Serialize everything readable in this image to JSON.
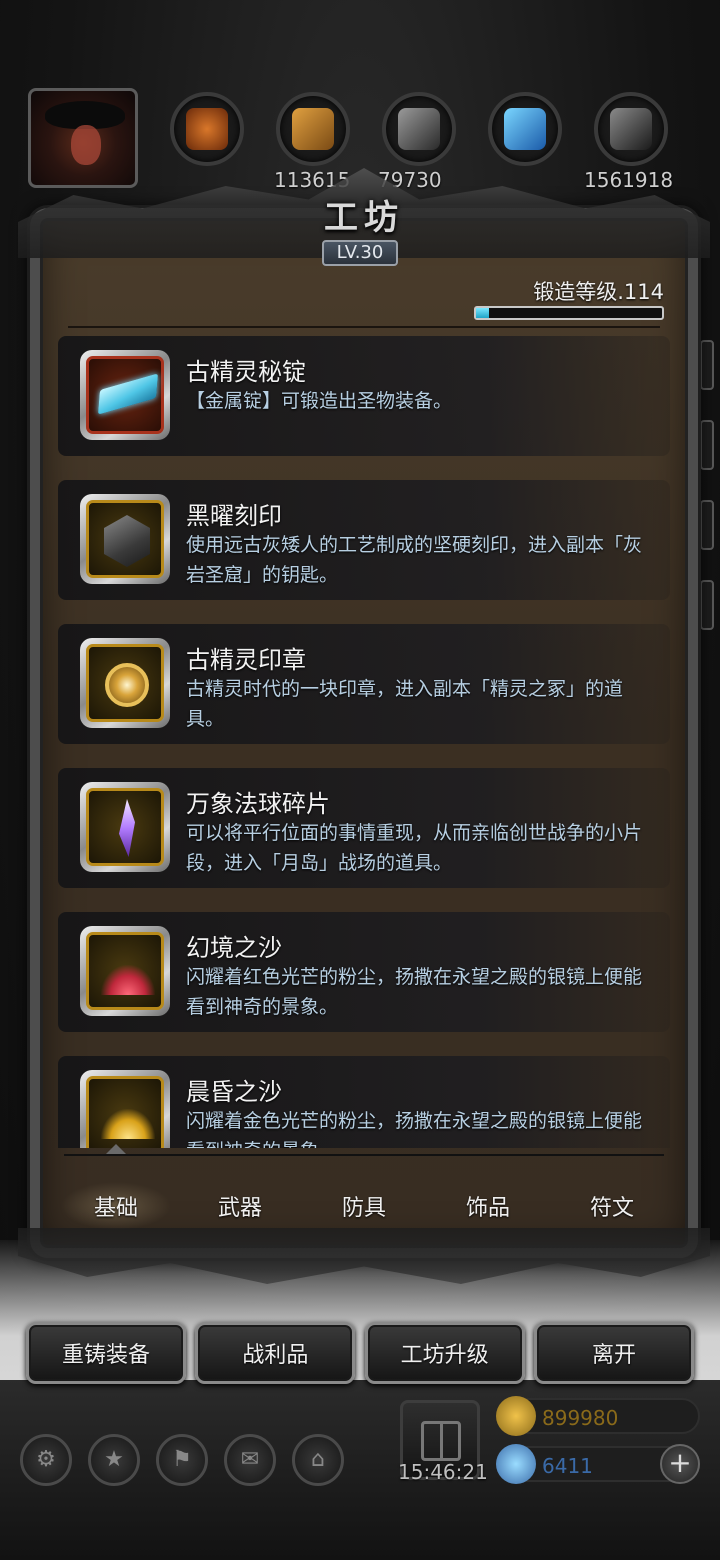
{
  "top_bar": {
    "resources": [
      {
        "icon": "ore-icon",
        "value": ""
      },
      {
        "icon": "wood-icon",
        "value": "113615"
      },
      {
        "icon": "stone-icon",
        "value": "79730"
      },
      {
        "icon": "crystal-icon",
        "value": ""
      },
      {
        "icon": "iron-icon",
        "value": "1561918"
      }
    ]
  },
  "panel": {
    "title": "工坊",
    "level": "LV.30",
    "forge_level_label": "锻造等级.114",
    "forge_progress": 0.07
  },
  "items": [
    {
      "title": "古精灵秘锭",
      "desc": "【金属锭】可锻造出圣物装备。",
      "icon": "ingot-icon",
      "frame": "red"
    },
    {
      "title": "黑曜刻印",
      "desc": "使用远古灰矮人的工艺制成的坚硬刻印，进入副本「灰岩圣窟」的钥匙。",
      "icon": "obsidian-seal-icon",
      "frame": "gold"
    },
    {
      "title": "古精灵印章",
      "desc": "古精灵时代的一块印章，进入副本「精灵之冢」的道具。",
      "icon": "elf-seal-icon",
      "frame": "gold"
    },
    {
      "title": "万象法球碎片",
      "desc": "可以将平行位面的事情重现，从而亲临创世战争的小片段，进入「月岛」战场的道具。",
      "icon": "crystal-shard-icon",
      "frame": "gold"
    },
    {
      "title": "幻境之沙",
      "desc": "闪耀着红色光芒的粉尘，扬撒在永望之殿的银镜上便能看到神奇的景象。",
      "icon": "red-sand-icon",
      "frame": "gold"
    },
    {
      "title": "晨昏之沙",
      "desc": "闪耀着金色光芒的粉尘，扬撒在永望之殿的银镜上便能看到神奇的景象。",
      "icon": "gold-sand-icon",
      "frame": "gold"
    }
  ],
  "tabs": [
    "基础",
    "武器",
    "防具",
    "饰品",
    "符文"
  ],
  "active_tab": "基础",
  "actions": [
    "重铸装备",
    "战利品",
    "工坊升级",
    "离开"
  ],
  "hud": {
    "timer": "15:46:21",
    "gold": "899980",
    "gems": "6411",
    "plus": "+",
    "colors": {
      "gold": "#8a6a1a",
      "gem": "#3a6aa8"
    }
  }
}
